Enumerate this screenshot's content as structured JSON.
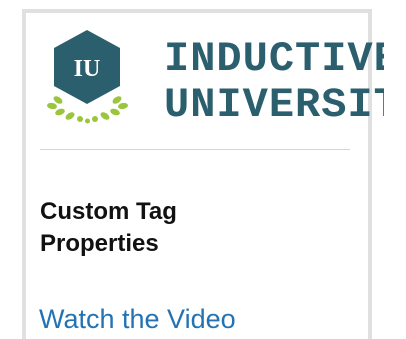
{
  "brand": {
    "badge_text": "IU",
    "line1": "INDUCTIVE",
    "line2": "UNIVERSITY",
    "colors": {
      "hex": "#2c5f6e",
      "laurel": "#9bc53d",
      "text": "#2c5f6e"
    }
  },
  "content": {
    "title": "Custom Tag Properties",
    "link_text": "Watch the Video"
  }
}
